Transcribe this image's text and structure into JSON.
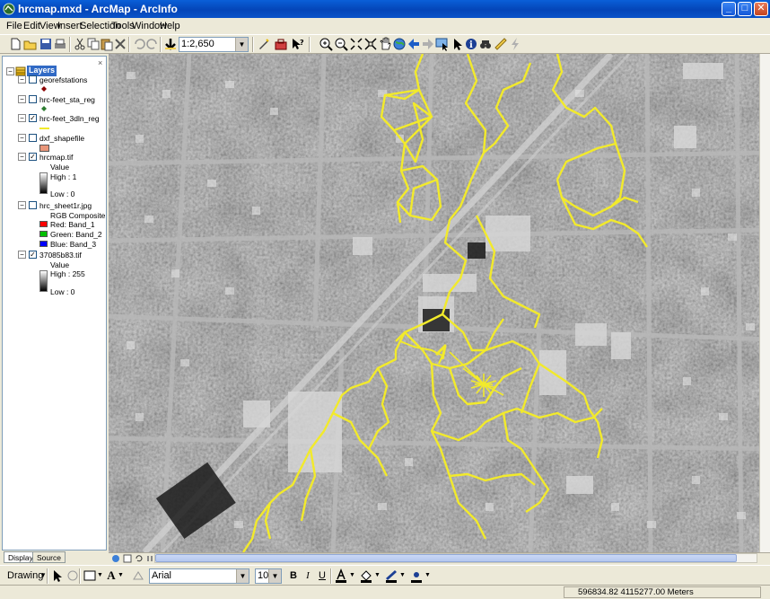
{
  "window": {
    "title": "hrcmap.mxd - ArcMap - ArcInfo",
    "minimize": "_",
    "maximize": "□",
    "close": "✕"
  },
  "menus": [
    "File",
    "Edit",
    "View",
    "Insert",
    "Selection",
    "Tools",
    "Window",
    "Help"
  ],
  "toolbar": {
    "scale": "1:2,650",
    "icons": [
      "new-document-icon",
      "open-folder-icon",
      "save-icon",
      "print-icon",
      "cut-icon",
      "copy-icon",
      "paste-icon",
      "delete-icon",
      "undo-icon",
      "redo-icon",
      "add-data-icon",
      "editor-icon",
      "arc-toolbox-icon",
      "whats-this-icon",
      "zoom-in-icon",
      "zoom-out-icon",
      "fixed-zoom-in-icon",
      "fixed-zoom-out-icon",
      "pan-icon",
      "full-extent-icon",
      "back-extent-icon",
      "forward-extent-icon",
      "select-features-icon",
      "select-elements-icon",
      "identify-icon",
      "find-icon",
      "measure-icon",
      "hyperlink-icon"
    ]
  },
  "toc": {
    "root": "Layers",
    "close": "×",
    "layers": [
      {
        "name": "georefstations",
        "checked": false
      },
      {
        "name": "hrc-feet_sta_reg",
        "checked": false
      },
      {
        "name": "hrc-feet_3dln_reg",
        "checked": true
      },
      {
        "name": "dxf_shapefile",
        "checked": false
      },
      {
        "name": "hrcmap.tif",
        "checked": true,
        "legend": {
          "title": "Value",
          "high": "High : 1",
          "low": "Low : 0"
        }
      },
      {
        "name": "hrc_sheet1r.jpg",
        "checked": false,
        "legend": {
          "title": "RGB Composite",
          "red": "Red:   Band_1",
          "green": "Green: Band_2",
          "blue": "Blue:   Band_3"
        }
      },
      {
        "name": "37085b83.tif",
        "checked": true,
        "legend": {
          "title": "Value",
          "high": "High : 255",
          "low": "Low : 0"
        }
      }
    ],
    "tabs": [
      "Display",
      "Source"
    ]
  },
  "colors": {
    "feature_line": "#f2ea2b",
    "station_marker": "#8b0000",
    "sta_reg_marker": "#2e7d32",
    "dxf_fill": "#e9967a",
    "band_red": "#ff0000",
    "band_green": "#00c000",
    "band_blue": "#0000ff"
  },
  "drawing": {
    "label": "Drawing",
    "font": "Arial",
    "size": "10",
    "bold": "B",
    "italic": "I",
    "underline": "U",
    "text_tool": "A"
  },
  "status": {
    "coordinates": "596834.82  4115277.00 Meters"
  }
}
